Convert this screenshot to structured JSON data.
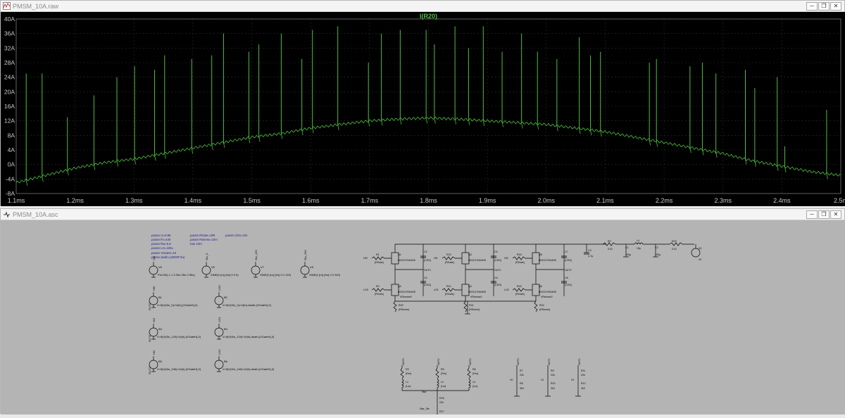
{
  "waveform_window": {
    "title": "PMSM_10A.raw",
    "buttons": [
      "minimize",
      "restore",
      "close"
    ]
  },
  "schematic_window": {
    "title": "PMSM_10A.asc",
    "buttons": [
      "minimize",
      "restore",
      "close"
    ]
  },
  "chart_data": {
    "type": "line",
    "title": "I(R20)",
    "xlabel": "",
    "ylabel": "",
    "xlim": [
      1.1,
      2.5
    ],
    "ylim": [
      -8,
      40
    ],
    "x_ticks": [
      "1.1ms",
      "1.2ms",
      "1.3ms",
      "1.4ms",
      "1.5ms",
      "1.6ms",
      "1.7ms",
      "1.8ms",
      "1.9ms",
      "2.0ms",
      "2.1ms",
      "2.2ms",
      "2.3ms",
      "2.4ms",
      "2.5m"
    ],
    "y_ticks": [
      "40A",
      "36A",
      "32A",
      "28A",
      "24A",
      "20A",
      "16A",
      "12A",
      "8A",
      "4A",
      "0A",
      "-4A",
      "-8A"
    ],
    "grid": true,
    "background": "#000000",
    "trace_color": "#4fbf3f",
    "series": [
      {
        "name": "I(R20)",
        "baseline_x": [
          1.1,
          1.15,
          1.2,
          1.25,
          1.3,
          1.35,
          1.4,
          1.45,
          1.5,
          1.55,
          1.6,
          1.65,
          1.7,
          1.75,
          1.8,
          1.85,
          1.9,
          1.95,
          2.0,
          2.05,
          2.1,
          2.15,
          2.2,
          2.25,
          2.3,
          2.35,
          2.4,
          2.45,
          2.5
        ],
        "baseline_y": [
          -5,
          -3,
          -1,
          0.5,
          1.5,
          3,
          4.5,
          6,
          7.5,
          8.5,
          10,
          11,
          12,
          12.5,
          12.8,
          12.5,
          12,
          11.5,
          11,
          10,
          9,
          7.5,
          6,
          4.5,
          3,
          1,
          -0.5,
          -2,
          -3
        ],
        "spike_x": [
          1.117,
          1.144,
          1.187,
          1.232,
          1.271,
          1.301,
          1.335,
          1.352,
          1.398,
          1.432,
          1.452,
          1.495,
          1.512,
          1.55,
          1.585,
          1.603,
          1.646,
          1.698,
          1.72,
          1.752,
          1.796,
          1.81,
          1.845,
          1.868,
          1.893,
          1.925,
          1.958,
          1.985,
          2.018,
          2.056,
          2.075,
          2.092,
          2.175,
          2.187,
          2.244,
          2.265,
          2.288,
          2.338,
          2.354,
          2.392,
          2.405,
          2.476
        ],
        "spike_y": [
          25,
          25,
          13,
          19,
          24,
          27,
          26,
          30,
          29,
          30,
          36,
          31,
          33,
          36,
          29,
          37,
          38,
          28,
          36,
          37,
          37,
          33,
          38,
          32,
          38,
          31,
          36,
          31,
          29,
          35,
          30,
          31,
          28,
          29,
          27,
          28,
          25,
          26,
          21,
          24,
          5,
          15
        ]
      }
    ]
  },
  "schematic": {
    "params": [
      ".param m=0.95",
      ".param fm=440",
      ".param fsw=0.6",
      ".param Lm=100u",
      ".param RGate=10R",
      ".param RSense=10m",
      ".tran 10m",
      ".param CDS=10n",
      ".param VGateH=10",
      ".param death=(20000^3u)"
    ],
    "sources": [
      {
        "name": "V5",
        "net": "Vtri",
        "value": "PULSE(-1 1 0 25u 25u 0 50u)"
      },
      {
        "name": "V6",
        "net": "Sin_0",
        "value": "SINE(0 {m} {fm} 0 0 0)"
      },
      {
        "name": "V7",
        "net": "Sin_120",
        "value": "SINE(0 {m} {fm} 0 0 120)"
      },
      {
        "name": "V8",
        "net": "Sin_240",
        "value": "SINE(0 {m} {fm} 0 0 240)"
      }
    ],
    "behavioral": [
      {
        "name": "B1",
        "net": "HI0",
        "label": "OUT0",
        "expr": "V=if(V(Sin_0)>V(tri),{VGateH},0)"
      },
      {
        "name": "B2",
        "net": "LO0",
        "label": "",
        "expr": "V=if(V(Sin_0)<V(tri)-death,{VGateH},0)"
      },
      {
        "name": "B3",
        "net": "HI1",
        "label": "OUT1",
        "expr": "V=if(V(Sin_120)>V(tri),{VGateH},0)"
      },
      {
        "name": "B4",
        "net": "LO1",
        "label": "",
        "expr": "V=if(V(Sin_120)<V(tri)-death,{VGateH},0)"
      },
      {
        "name": "B5",
        "net": "HI2",
        "label": "OUT2",
        "expr": "V=if(V(Sin_240)>V(tri),{VGateH},0)"
      },
      {
        "name": "B6",
        "net": "LO2",
        "label": "",
        "expr": "V=if(V(Sin_240)<V(tri)-death,{VGateH},0)"
      }
    ],
    "legs": [
      {
        "hi_in": "HI0",
        "lo_in": "LO0",
        "rh": "R1",
        "rl": "R4",
        "qh": "Q1",
        "ql": "Q2",
        "ch": "C2",
        "cl": "C4",
        "rs": "R20",
        "out": "OUT0",
        "sense": "VRsense0"
      },
      {
        "hi_in": "HI1",
        "lo_in": "LO1",
        "rh": "R13",
        "rl": "R14",
        "qh": "Q3",
        "ql": "Q4",
        "ch": "C5",
        "cl": "C6",
        "rs": "R21",
        "out": "OUT1",
        "sense": "VRsense1"
      },
      {
        "hi_in": "HI2",
        "lo_in": "LO2",
        "rh": "R15",
        "rl": "R16",
        "qh": "Q5",
        "ql": "Q6",
        "ch": "C7",
        "cl": "C8",
        "rs": "R22",
        "out": "OUT2",
        "sense": "VRsense2"
      }
    ],
    "mosfet": "BSC017N04NS",
    "rgate": "{RGate}",
    "cds": "{CDS}",
    "rsense": "{RSense}",
    "supply": {
      "c9": "C9",
      "c9v": "4.7µ",
      "r2": "R2",
      "r2v": "0.01",
      "l4": "L4",
      "l4v": "10p",
      "c1": "C1",
      "c1v": "100µ",
      "c3": "C3",
      "c3v": "100µ",
      "r19": "R19",
      "r19v": "0.01",
      "v4": "V4",
      "v4v": "24"
    },
    "load": [
      {
        "net": "OUT0",
        "r": "R3",
        "rv": "{Rm}",
        "l": "L1",
        "lv": "{Lm}"
      },
      {
        "net": "OUT1",
        "r": "R5",
        "rv": "{Rm}",
        "l": "L2",
        "lv": "{Lm}"
      },
      {
        "net": "OUT2",
        "r": "R6",
        "rv": "{Rm}",
        "l": "L3",
        "lv": "{Lm}"
      }
    ],
    "star": {
      "label": "Star",
      "label2": "Star_3fe",
      "r18": "R18",
      "r18v": "22k",
      "r17": "R17",
      "r17v": "3k3"
    },
    "dividers": [
      {
        "net": "OUT0",
        "vn": "V0",
        "ra": "R7",
        "rav": "22k",
        "rb": "R8",
        "rbv": "3k3"
      },
      {
        "net": "OUT1",
        "vn": "V1",
        "ra": "R9",
        "rav": "22k",
        "rb": "R10",
        "rbv": "3k3"
      },
      {
        "net": "OUT2",
        "vn": "V2",
        "ra": "R11",
        "rav": "22k",
        "rb": "R12",
        "rbv": "3k3"
      }
    ]
  }
}
